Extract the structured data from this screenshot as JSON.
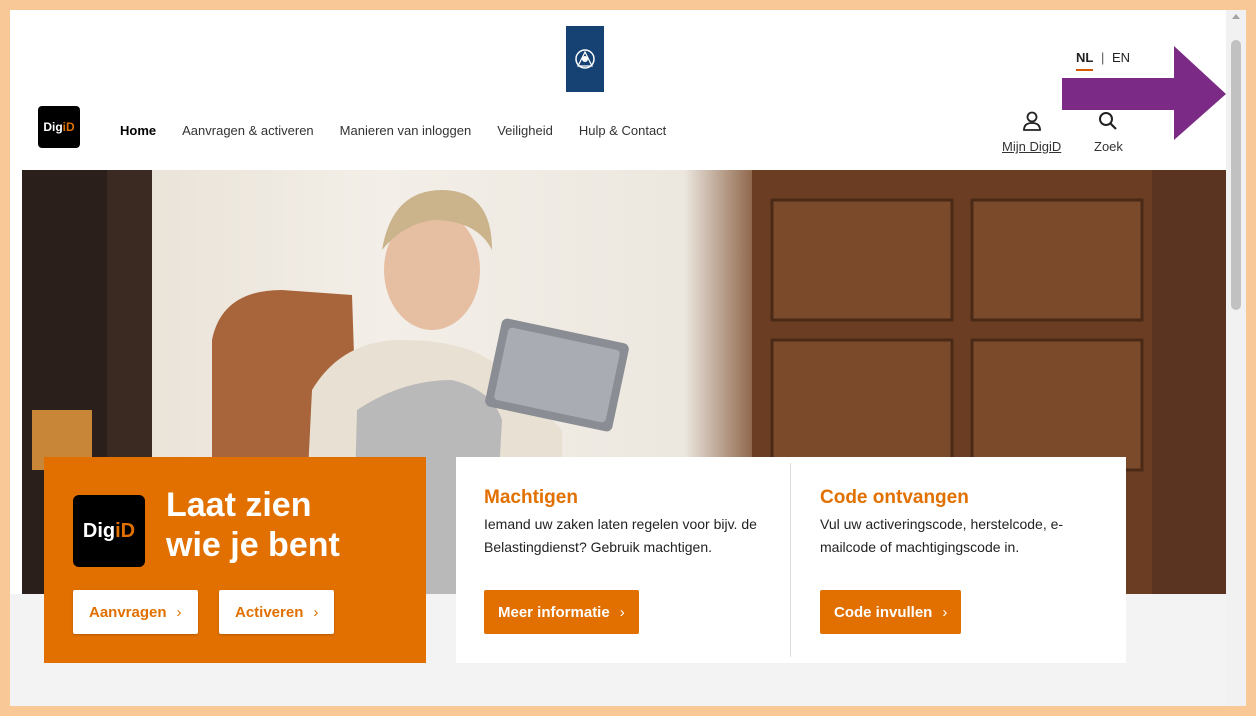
{
  "header": {
    "lang_active": "NL",
    "lang_sep": "|",
    "lang_other": "EN",
    "logo_text_a": "Dig",
    "logo_text_b": "iD",
    "nav": {
      "home": "Home",
      "aanvragen": "Aanvragen & activeren",
      "inloggen": "Manieren van inloggen",
      "veiligheid": "Veiligheid",
      "hulp": "Hulp & Contact"
    },
    "mijn_digid": "Mijn DigiD",
    "zoek": "Zoek"
  },
  "hero": {
    "logo_text_a": "Dig",
    "logo_text_b": "iD",
    "tagline_line1": "Laat zien",
    "tagline_line2": "wie je bent",
    "btn_aanvragen": "Aanvragen",
    "btn_activeren": "Activeren",
    "chevron": "›"
  },
  "cards": {
    "machtigen": {
      "title": "Machtigen",
      "text": "Iemand uw zaken laten regelen voor bijv. de Belastingdienst? Gebruik machtigen.",
      "button": "Meer informatie"
    },
    "code": {
      "title": "Code ontvangen",
      "text": "Vul uw activeringscode, herstelcode, e-mailcode of machtigingscode in.",
      "button": "Code invullen"
    }
  },
  "colors": {
    "accent": "#e17000",
    "crest": "#154273",
    "annotation_arrow": "#7b2a86",
    "frame": "#f8c896"
  }
}
